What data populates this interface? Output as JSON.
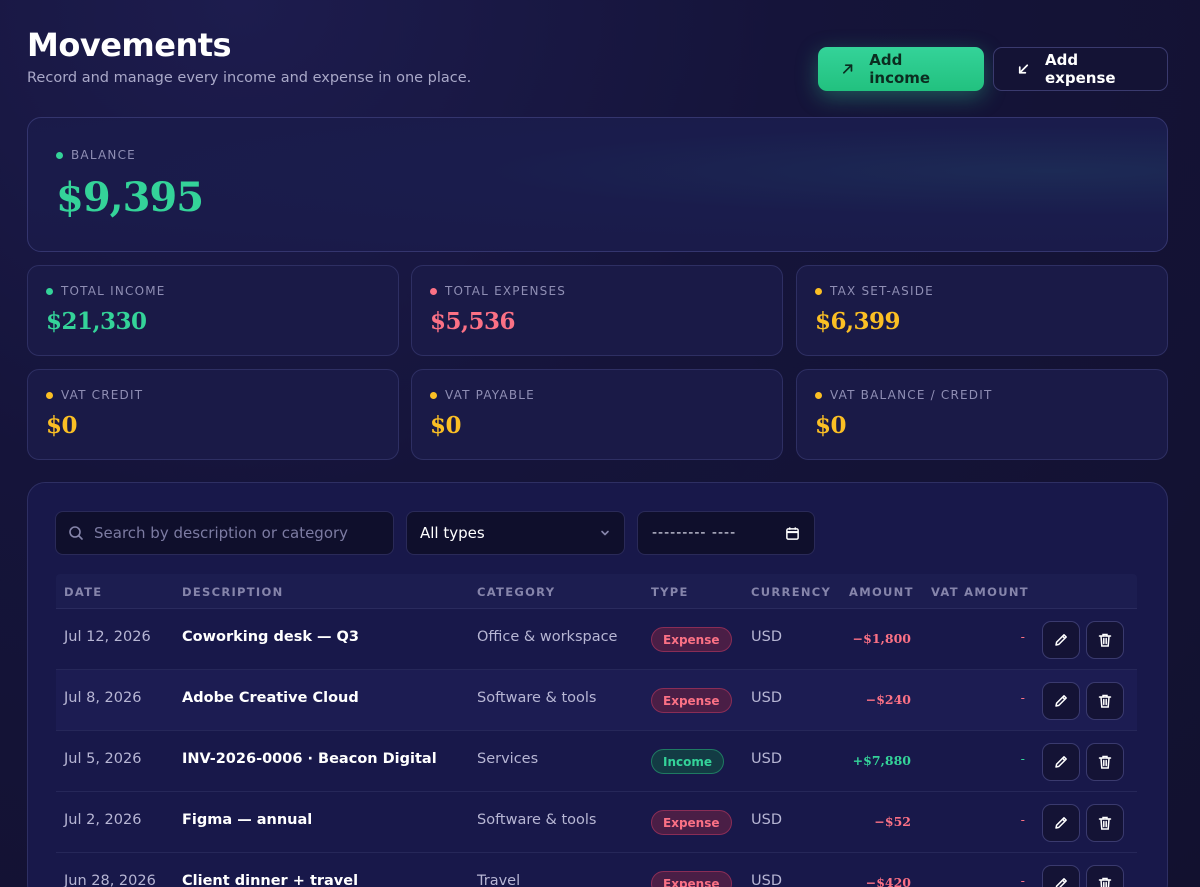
{
  "header": {
    "title": "Movements",
    "subtitle": "Record and manage every income and expense in one place.",
    "add_income_label": "Add income",
    "add_expense_label": "Add expense"
  },
  "balance": {
    "label": "BALANCE",
    "value": "$9,395"
  },
  "stats": [
    {
      "label": "TOTAL INCOME",
      "value": "$21,330",
      "color": "#34d399"
    },
    {
      "label": "TOTAL EXPENSES",
      "value": "$5,536",
      "color": "#fb7185"
    },
    {
      "label": "TAX SET-ASIDE",
      "value": "$6,399",
      "color": "#fbbf24"
    },
    {
      "label": "VAT CREDIT",
      "value": "$0",
      "color": "#fbbf24"
    },
    {
      "label": "VAT PAYABLE",
      "value": "$0",
      "color": "#fbbf24"
    },
    {
      "label": "VAT BALANCE / CREDIT",
      "value": "$0",
      "color": "#fbbf24"
    }
  ],
  "filters": {
    "search_placeholder": "Search by description or category",
    "type_selected": "All types",
    "date_value": "--------- ----"
  },
  "table": {
    "columns": [
      "DATE",
      "DESCRIPTION",
      "CATEGORY",
      "TYPE",
      "CURRENCY",
      "AMOUNT",
      "VAT AMOUNT"
    ],
    "rows": [
      {
        "date": "Jul 12, 2026",
        "description": "Coworking desk — Q3",
        "category": "Office & workspace",
        "type": "Expense",
        "currency": "USD",
        "amount": "−$1,800",
        "vat": "-"
      },
      {
        "date": "Jul 8, 2026",
        "description": "Adobe Creative Cloud",
        "category": "Software & tools",
        "type": "Expense",
        "currency": "USD",
        "amount": "−$240",
        "vat": "-"
      },
      {
        "date": "Jul 5, 2026",
        "description": "INV-2026-0006 · Beacon Digital",
        "category": "Services",
        "type": "Income",
        "currency": "USD",
        "amount": "+$7,880",
        "vat": "-"
      },
      {
        "date": "Jul 2, 2026",
        "description": "Figma — annual",
        "category": "Software & tools",
        "type": "Expense",
        "currency": "USD",
        "amount": "−$52",
        "vat": "-"
      },
      {
        "date": "Jun 28, 2026",
        "description": "Client dinner + travel",
        "category": "Travel",
        "type": "Expense",
        "currency": "USD",
        "amount": "−$420",
        "vat": "-"
      }
    ]
  },
  "colors": {
    "income": "#34d399",
    "expense": "#fb7185",
    "tax": "#fbbf24",
    "background": "#15143a"
  }
}
